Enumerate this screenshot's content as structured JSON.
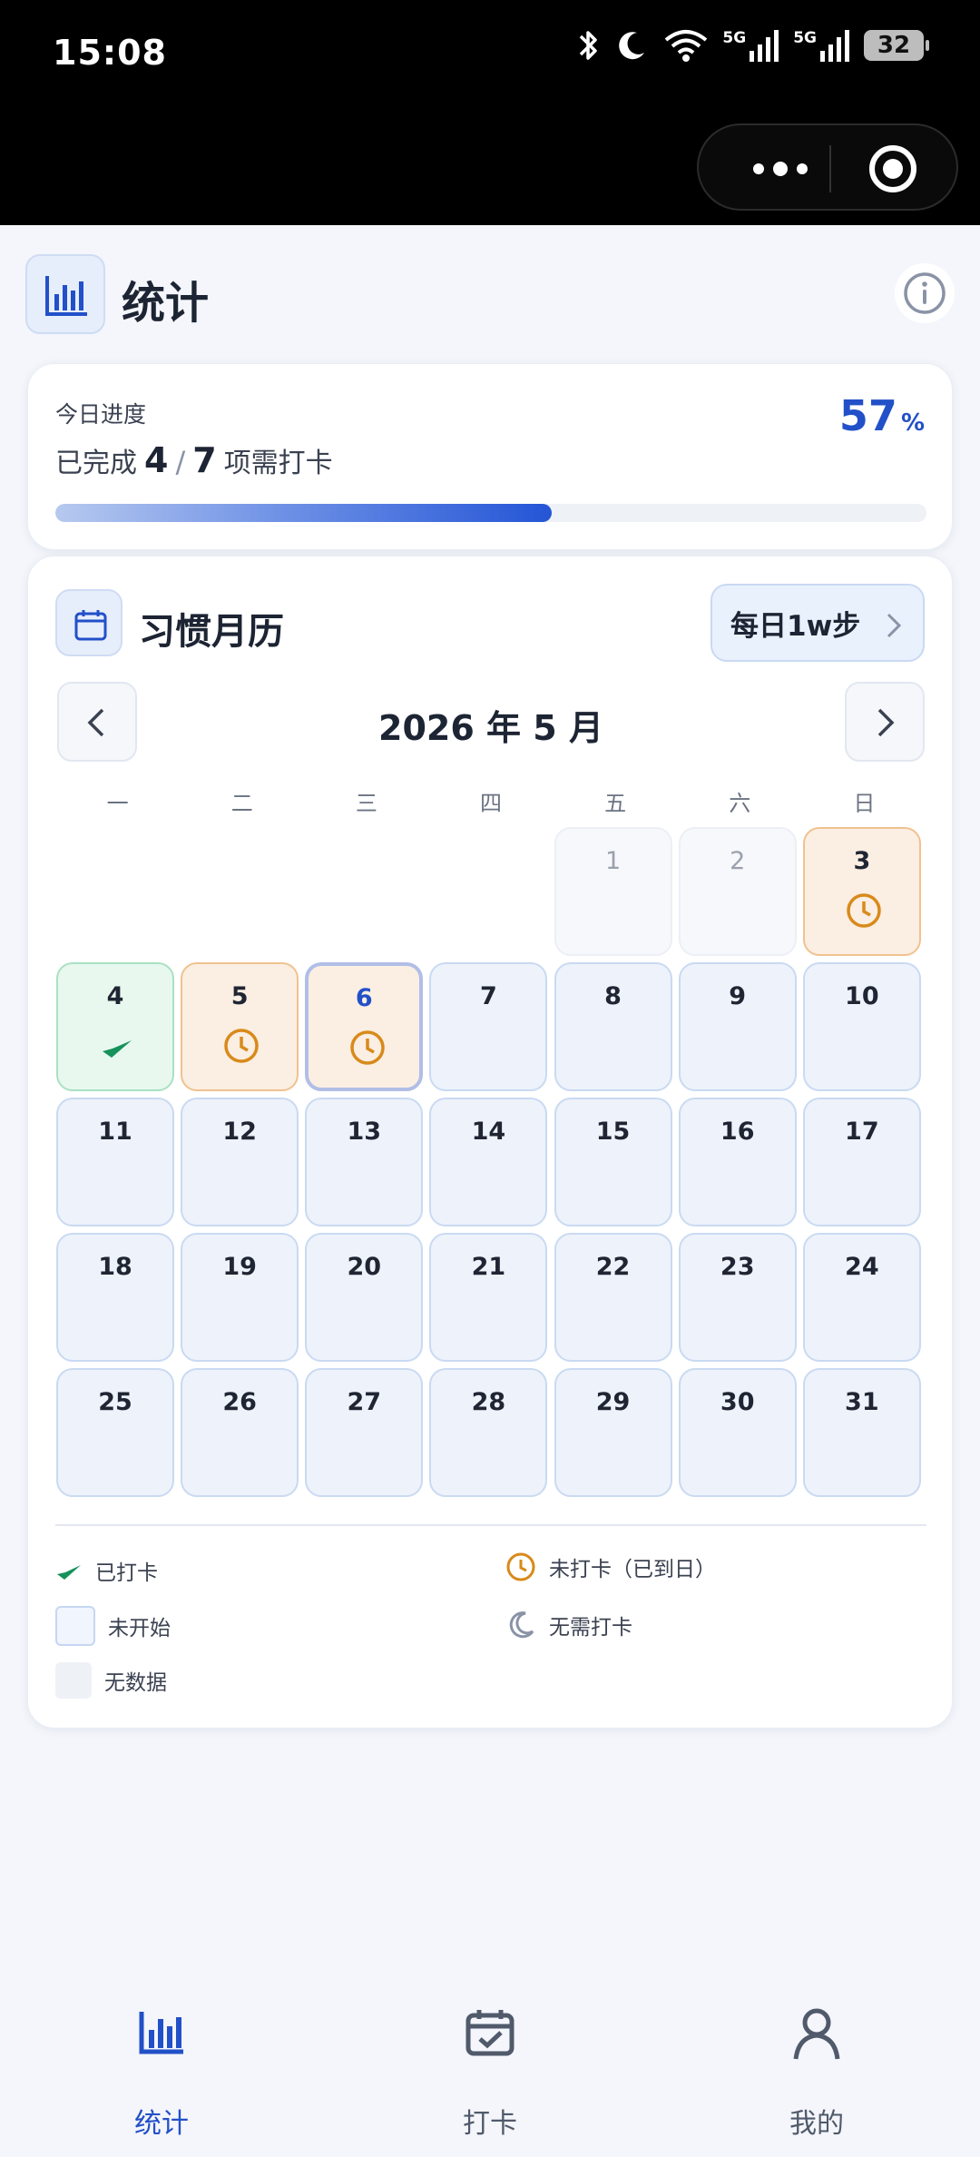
{
  "status_bar": {
    "time": "15:08",
    "network": "5G",
    "battery": "32"
  },
  "header": {
    "title": "统计"
  },
  "progress": {
    "label": "今日进度",
    "prefix": "已完成",
    "done": "4",
    "slash": "/",
    "total": "7",
    "suffix": "项需打卡",
    "percent_value": "57",
    "percent_unit": "%",
    "fraction": 0.57
  },
  "calendar": {
    "title": "习惯月历",
    "habit_selector": "每日1w步",
    "month_title": "2026 年 5 月",
    "weekdays": [
      "一",
      "二",
      "三",
      "四",
      "五",
      "六",
      "日"
    ],
    "first_weekday_index": 4,
    "today": 6,
    "days": [
      {
        "day": "1",
        "status": "nodata"
      },
      {
        "day": "2",
        "status": "nodata"
      },
      {
        "day": "3",
        "status": "missed"
      },
      {
        "day": "4",
        "status": "done"
      },
      {
        "day": "5",
        "status": "missed"
      },
      {
        "day": "6",
        "status": "missed"
      },
      {
        "day": "7",
        "status": "notstarted"
      },
      {
        "day": "8",
        "status": "notstarted"
      },
      {
        "day": "9",
        "status": "notstarted"
      },
      {
        "day": "10",
        "status": "notstarted"
      },
      {
        "day": "11",
        "status": "notstarted"
      },
      {
        "day": "12",
        "status": "notstarted"
      },
      {
        "day": "13",
        "status": "notstarted"
      },
      {
        "day": "14",
        "status": "notstarted"
      },
      {
        "day": "15",
        "status": "notstarted"
      },
      {
        "day": "16",
        "status": "notstarted"
      },
      {
        "day": "17",
        "status": "notstarted"
      },
      {
        "day": "18",
        "status": "notstarted"
      },
      {
        "day": "19",
        "status": "notstarted"
      },
      {
        "day": "20",
        "status": "notstarted"
      },
      {
        "day": "21",
        "status": "notstarted"
      },
      {
        "day": "22",
        "status": "notstarted"
      },
      {
        "day": "23",
        "status": "notstarted"
      },
      {
        "day": "24",
        "status": "notstarted"
      },
      {
        "day": "25",
        "status": "notstarted"
      },
      {
        "day": "26",
        "status": "notstarted"
      },
      {
        "day": "27",
        "status": "notstarted"
      },
      {
        "day": "28",
        "status": "notstarted"
      },
      {
        "day": "29",
        "status": "notstarted"
      },
      {
        "day": "30",
        "status": "notstarted"
      },
      {
        "day": "31",
        "status": "notstarted"
      }
    ],
    "legend": {
      "done": "已打卡",
      "missed": "未打卡（已到日）",
      "notstarted": "未开始",
      "not_required": "无需打卡",
      "nodata": "无数据"
    }
  },
  "colors": {
    "accent": "#2250c8",
    "done": "#16925a",
    "missed": "#d88a1a"
  },
  "bottom_nav": {
    "tabs": [
      {
        "label": "统计",
        "icon": "bar-chart-icon",
        "active": true
      },
      {
        "label": "打卡",
        "icon": "calendar-check-icon",
        "active": false
      },
      {
        "label": "我的",
        "icon": "user-icon",
        "active": false
      }
    ]
  }
}
